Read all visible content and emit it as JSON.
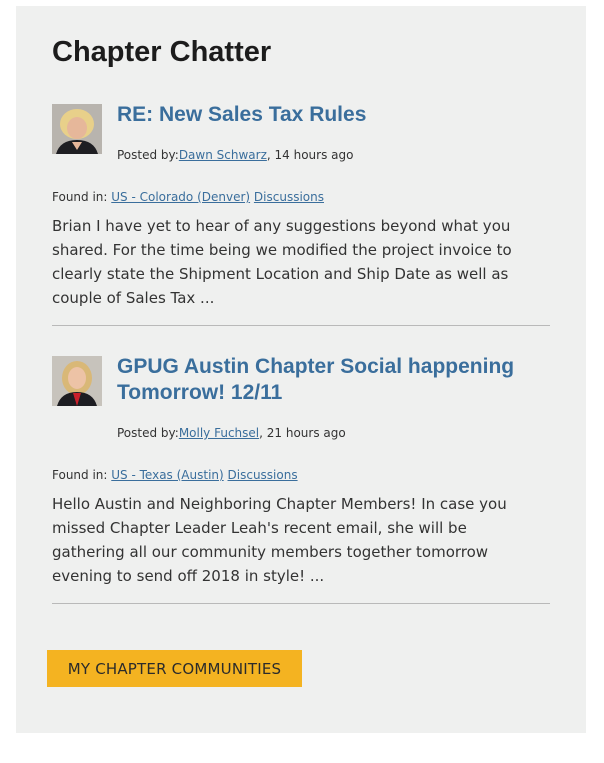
{
  "widget": {
    "title": "Chapter Chatter",
    "cta_label": "MY CHAPTER COMMUNITIES"
  },
  "posts": [
    {
      "title": "RE: New Sales Tax Rules",
      "posted_by_prefix": "Posted by:",
      "author": "Dawn Schwarz",
      "time_suffix": ", 14 hours ago",
      "found_in_prefix": "Found in: ",
      "community": "US - Colorado (Denver)",
      "section": "Discussions",
      "excerpt": "Brian I have yet to hear of any suggestions beyond what you shared.  For the time being we modified the project invoice to clearly state the Shipment Location and Ship Date as well as couple of Sales Tax ..."
    },
    {
      "title": "GPUG Austin Chapter Social happening Tomorrow! 12/11",
      "posted_by_prefix": "Posted by:",
      "author": "Molly Fuchsel",
      "time_suffix": ", 21 hours ago",
      "found_in_prefix": "Found in: ",
      "community": "US - Texas (Austin)",
      "section": "Discussions",
      "excerpt": "Hello Austin and Neighboring Chapter Members! In case you missed Chapter Leader Leah's recent email, she will be gathering all our community members together tomorrow evening to send off 2018 in style!  ..."
    }
  ],
  "colors": {
    "panel_bg": "#eff0ef",
    "link": "#3a6e9c",
    "cta_bg": "#f4b321",
    "divider": "#b9b9b9"
  }
}
